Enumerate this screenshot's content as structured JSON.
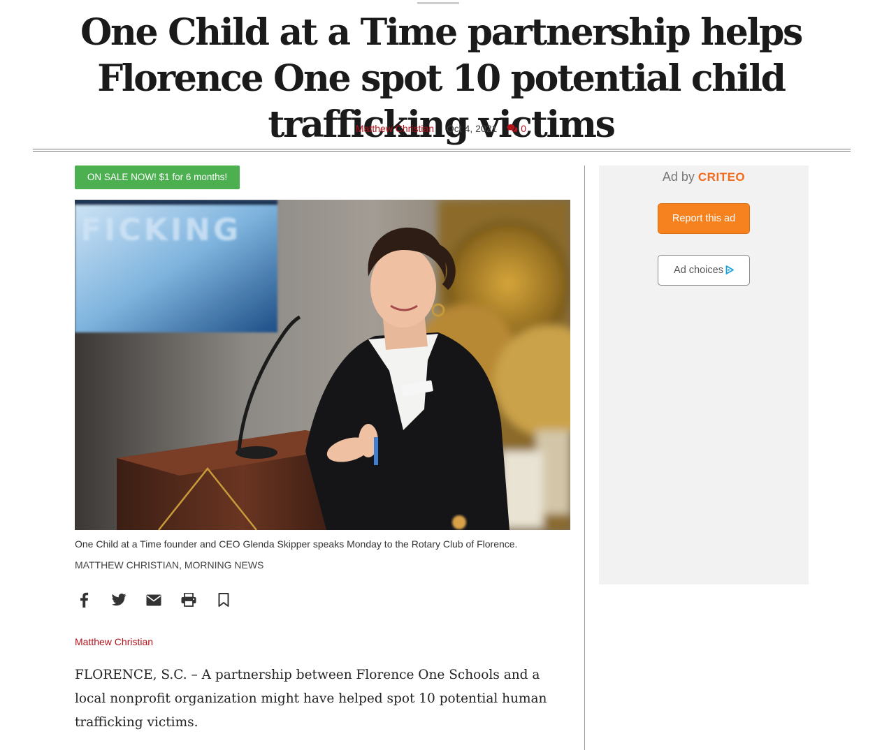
{
  "article": {
    "headline": "One Child at a Time partnership helps Florence One spot 10 potential child trafficking victims",
    "byline": {
      "author": "Matthew Christian",
      "date": "Oct 4, 2021",
      "comment_count": "0",
      "comment_icon": "comments-icon"
    },
    "promo_label": "ON SALE NOW! $1 for 6 months!",
    "photo": {
      "backdrop_text": "FICKING",
      "caption": "One Child at a Time founder and CEO Glenda Skipper speaks Monday to the Rotary Club of Florence.",
      "credit": "MATTHEW CHRISTIAN, MORNING NEWS"
    },
    "share_icons": [
      "facebook-icon",
      "twitter-icon",
      "email-icon",
      "print-icon",
      "bookmark-icon"
    ],
    "author_link": "Matthew Christian",
    "lede": "FLORENCE, S.C. – A partnership between Florence One Schools and a local nonprofit organization might have helped spot 10 potential human trafficking victims."
  },
  "ad": {
    "ad_by_label": "Ad by",
    "brand": "CRITEO",
    "report_label": "Report this ad",
    "choices_label": "Ad choices",
    "choices_icon": "adchoices-icon"
  },
  "colors": {
    "accent_red": "#b3121b",
    "promo_green": "#4caf50",
    "report_orange": "#f5821f",
    "criteo_orange": "#f26b1d",
    "adchoices_blue": "#1aa3d9",
    "ad_background": "#f2f2f2"
  }
}
